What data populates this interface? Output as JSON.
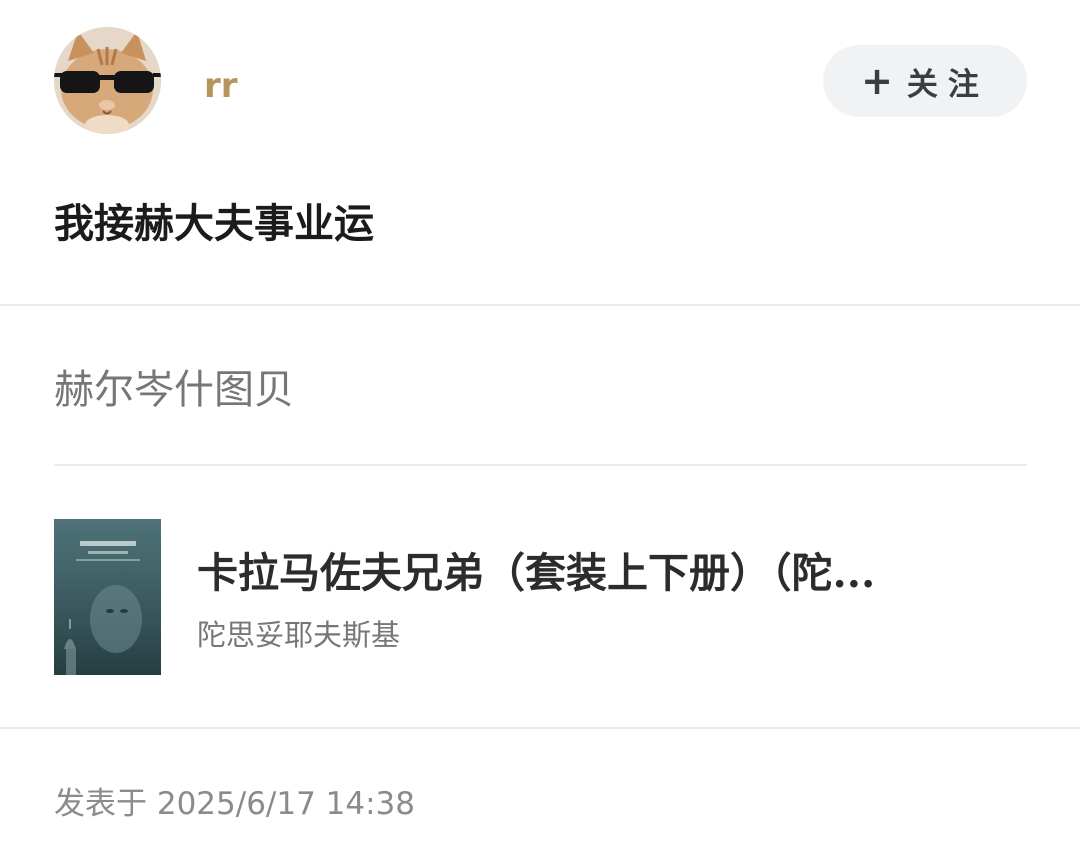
{
  "post": {
    "author": {
      "username": "rr",
      "avatar_icon": "cat-sunglasses-avatar"
    },
    "follow_button": {
      "plus_icon": "+",
      "label": "关注"
    },
    "title": "我接赫大夫事业运",
    "topic": "赫尔岑什图贝",
    "book": {
      "cover_icon": "book-cover-image",
      "title": "卡拉马佐夫兄弟（套装上下册）（陀...",
      "author": "陀思妥耶夫斯基"
    },
    "timestamp": "发表于 2025/6/17 14:38"
  },
  "colors": {
    "username": "#b4965a",
    "follow_bg": "#f1f2f4",
    "divider": "#ebebeb",
    "title_text": "#1b1b1b",
    "muted_text": "#767676"
  }
}
